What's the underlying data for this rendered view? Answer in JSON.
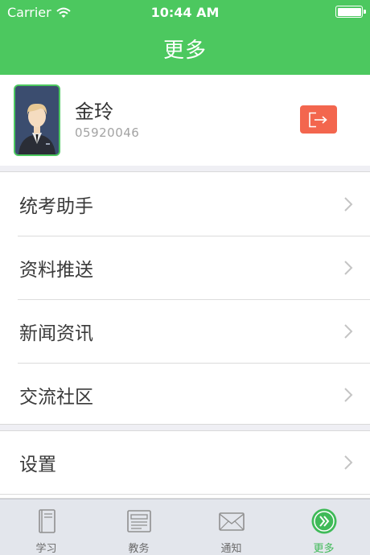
{
  "status_bar": {
    "carrier": "Carrier",
    "time": "10:44 AM"
  },
  "header": {
    "title": "更多"
  },
  "profile": {
    "name": "金玲",
    "user_id": "05920046"
  },
  "menu": {
    "group1": [
      {
        "label": "统考助手"
      },
      {
        "label": "资料推送"
      },
      {
        "label": "新闻资讯"
      },
      {
        "label": "交流社区"
      }
    ],
    "group2": [
      {
        "label": "设置"
      }
    ]
  },
  "tabs": [
    {
      "label": "学习",
      "icon": "book-icon"
    },
    {
      "label": "教务",
      "icon": "document-icon"
    },
    {
      "label": "通知",
      "icon": "mail-icon"
    },
    {
      "label": "更多",
      "icon": "more-icon",
      "active": true
    }
  ],
  "colors": {
    "brand_green": "#4cc85f",
    "logout_red": "#f3664e",
    "tab_active": "#3fba58"
  }
}
